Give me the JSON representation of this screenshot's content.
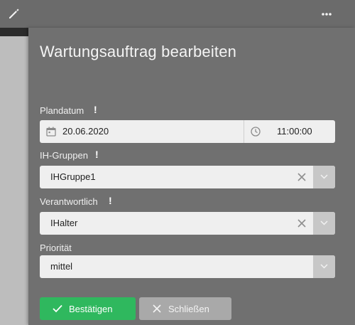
{
  "header": {
    "edit_icon": "pencil-icon",
    "menu_icon": "more-horizontal-icon"
  },
  "dialog": {
    "title": "Wartungsauftrag bearbeiten",
    "required_mark": "!",
    "plandatum": {
      "label": "Plandatum",
      "date": "20.06.2020",
      "time": "11:00:00"
    },
    "ih_gruppen": {
      "label": "IH-Gruppen",
      "value": "IHGruppe1"
    },
    "verantwortlich": {
      "label": "Verantwortlich",
      "value": "IHalter"
    },
    "prioritaet": {
      "label": "Priorität",
      "value": "mittel"
    },
    "buttons": {
      "confirm": "Bestätigen",
      "close": "Schließen"
    }
  },
  "colors": {
    "confirm": "#2fb85e",
    "close": "#a9a9a9",
    "overlay": "#707070"
  }
}
